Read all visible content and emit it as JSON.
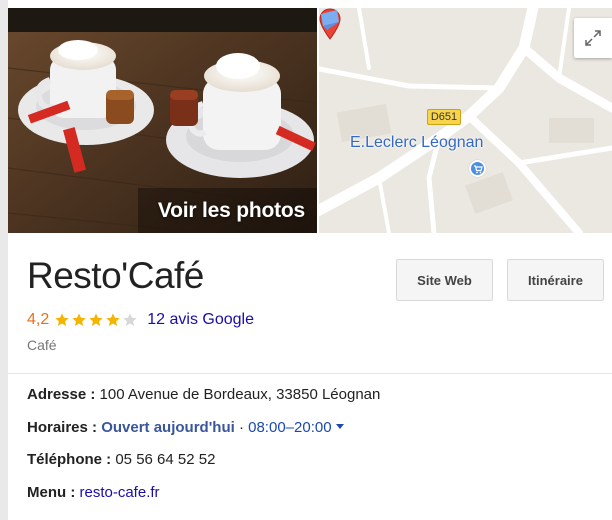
{
  "hero": {
    "photos_label": "Voir les photos",
    "map": {
      "place_label": "E.Leclerc Léognan",
      "road_label": "D651"
    }
  },
  "place": {
    "name": "Resto'Café",
    "rating": "4,2",
    "rating_stars": 4.2,
    "reviews": "12 avis Google",
    "category": "Café"
  },
  "actions": {
    "website": "Site Web",
    "directions": "Itinéraire"
  },
  "details": {
    "address_label": "Adresse :",
    "address": "100 Avenue de Bordeaux, 33850 Léognan",
    "hours_label": "Horaires :",
    "hours_status": "Ouvert aujourd'hui",
    "hours_separator": "·",
    "hours_range": "08:00–20:00",
    "phone_label": "Téléphone :",
    "phone": "05 56 64 52 52",
    "menu_label": "Menu :",
    "menu_link": "resto-cafe.fr"
  },
  "colors": {
    "star": "#f4b400",
    "star_empty": "#d7d7d7",
    "rating": "#e7711b",
    "link": "#1a0dab",
    "pin": "#e94335"
  }
}
